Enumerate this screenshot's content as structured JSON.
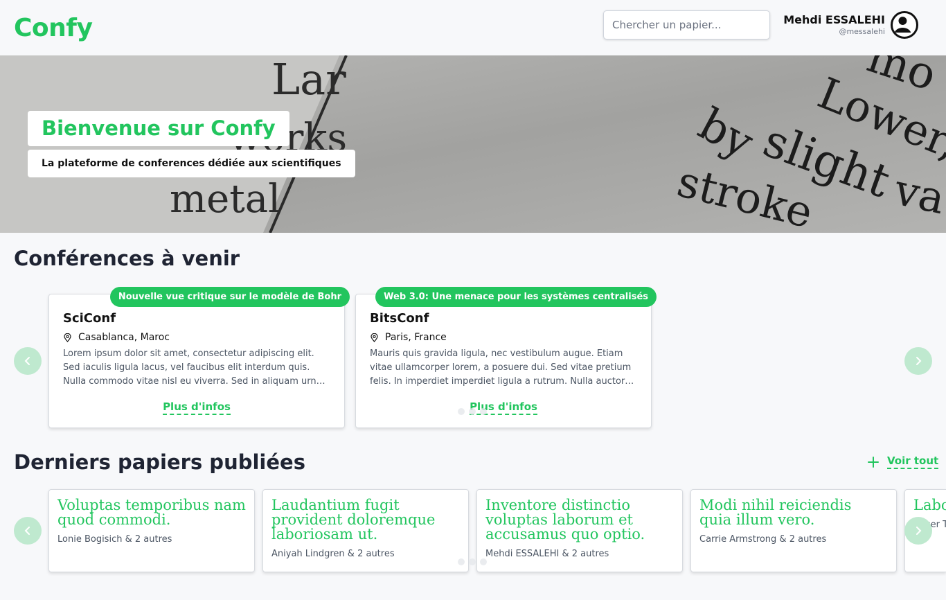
{
  "app": {
    "logo": "Confy"
  },
  "search": {
    "placeholder": "Chercher un papier..."
  },
  "user": {
    "name": "Mehdi ESSALEHI",
    "handle": "@messalehi"
  },
  "hero": {
    "title": "Bienvenue sur Confy",
    "subtitle": "La plateforme de conferences dédiée aux scientifiques",
    "background_words": [
      "Lar",
      "works",
      "metal",
      "by",
      "slight",
      "stroke",
      "mo",
      "Lower,",
      "va"
    ]
  },
  "conferences": {
    "title": "Conférences à venir",
    "items": [
      {
        "tag": "Nouvelle vue critique sur le modèle de Bohr",
        "name": "SciConf",
        "location": "Casablanca, Maroc",
        "description": "Lorem ipsum dolor sit amet, consectetur adipiscing elit. Sed iaculis ligula lacus, vel faucibus elit interdum quis. Nulla commodo vitae nisl eu viverra. Sed in aliquam urna, ut…",
        "more": "Plus d'infos"
      },
      {
        "tag": "Web 3.0: Une menace pour les systèmes centralisés",
        "name": "BitsConf",
        "location": "Paris, France",
        "description": "Mauris quis gravida ligula, nec vestibulum augue. Etiam vitae ullamcorper lorem, a posuere dui. Sed vitae pretium felis. In imperdiet imperdiet ligula a rutrum. Nulla auctor aliquet ero…",
        "more": "Plus d'infos"
      }
    ]
  },
  "papers": {
    "title": "Derniers papiers publiées",
    "see_all": "Voir tout",
    "items": [
      {
        "title": "Voluptas temporibus nam quod commodi.",
        "authors": "Lonie Bogisich & 2 autres"
      },
      {
        "title": "Laudantium fugit provident doloremque laboriosam ut.",
        "authors": "Aniyah Lindgren & 2 autres"
      },
      {
        "title": "Inventore distinctio voluptas laborum et accusamus quo optio.",
        "authors": "Mehdi ESSALEHI & 2 autres"
      },
      {
        "title": "Modi nihil reiciendis quia illum vero.",
        "authors": "Carrie Armstrong & 2 autres"
      },
      {
        "title": "Labo reru",
        "authors": "Roger T"
      }
    ]
  },
  "colors": {
    "accent": "#22c55e",
    "accent_soft": "#bfe9cf",
    "text": "#1f2433"
  }
}
